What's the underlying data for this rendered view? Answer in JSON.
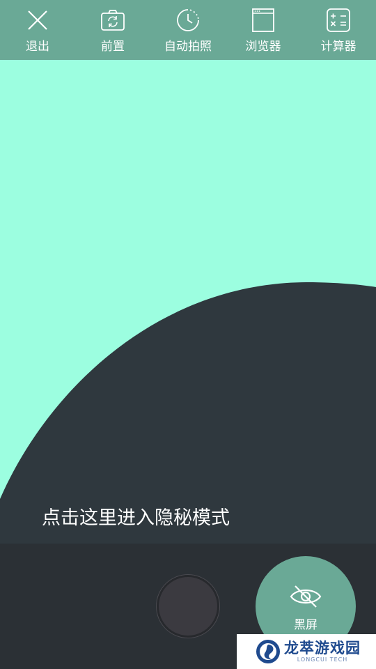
{
  "toolbar": {
    "items": [
      {
        "label": "退出",
        "icon": "close-icon"
      },
      {
        "label": "前置",
        "icon": "switch-camera-icon"
      },
      {
        "label": "自动拍照",
        "icon": "timer-icon"
      },
      {
        "label": "浏览器",
        "icon": "browser-icon"
      },
      {
        "label": "计算器",
        "icon": "calculator-icon"
      }
    ]
  },
  "preview": {
    "hint": "点击这里进入隐秘模式"
  },
  "bottom": {
    "shutter_icon": "shutter-button",
    "blackscreen_label": "黑屏",
    "blackscreen_icon": "eye-off-icon"
  },
  "watermark": {
    "name": "龙萃游戏园",
    "subtitle": "LONGCUI TECH"
  },
  "colors": {
    "toolbar_bg": "#6aa996",
    "preview_bg": "#9cfee0",
    "dark_area": "#2f383e",
    "bottom_bg": "#2b3035",
    "accent": "#6aa996"
  }
}
